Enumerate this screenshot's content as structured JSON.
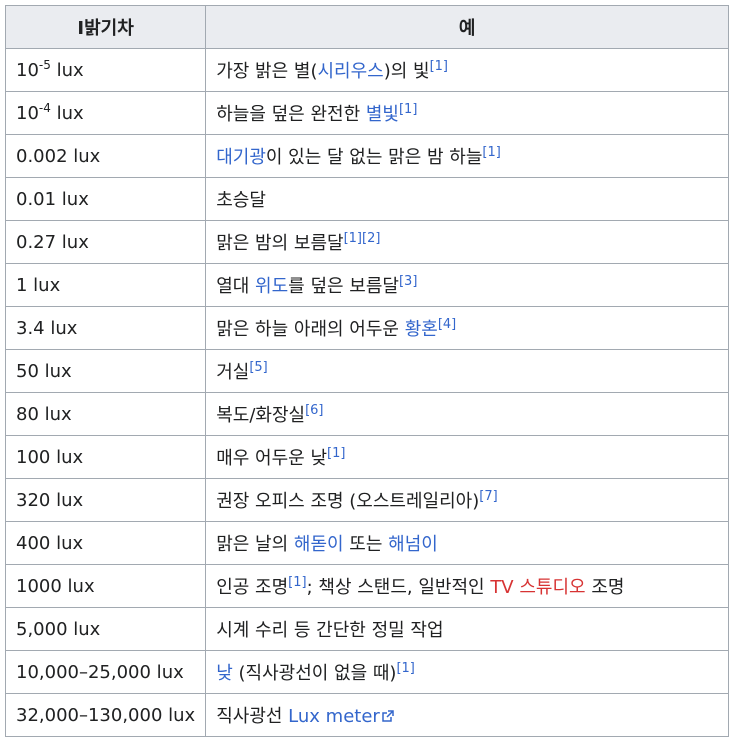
{
  "table": {
    "headers": [
      "I밝기차",
      "예"
    ],
    "rows": [
      {
        "lux": {
          "base": "10",
          "exp": "-5",
          "unit": " lux"
        },
        "parts": [
          {
            "t": "text",
            "v": "가장 밝은 별("
          },
          {
            "t": "link",
            "v": "시리우스"
          },
          {
            "t": "text",
            "v": ")의 빛"
          },
          {
            "t": "ref",
            "v": "[1]"
          }
        ]
      },
      {
        "lux": {
          "base": "10",
          "exp": "-4",
          "unit": " lux"
        },
        "parts": [
          {
            "t": "text",
            "v": "하늘을 덮은 완전한 "
          },
          {
            "t": "link",
            "v": "별빛"
          },
          {
            "t": "ref",
            "v": "[1]"
          }
        ]
      },
      {
        "lux": {
          "text": "0.002 lux"
        },
        "parts": [
          {
            "t": "link",
            "v": "대기광"
          },
          {
            "t": "text",
            "v": "이 있는 달 없는 맑은 밤 하늘"
          },
          {
            "t": "ref",
            "v": "[1]"
          }
        ]
      },
      {
        "lux": {
          "text": "0.01 lux"
        },
        "parts": [
          {
            "t": "text",
            "v": "초승달"
          }
        ]
      },
      {
        "lux": {
          "text": "0.27 lux"
        },
        "parts": [
          {
            "t": "text",
            "v": "맑은 밤의 보름달"
          },
          {
            "t": "ref",
            "v": "[1]"
          },
          {
            "t": "ref",
            "v": "[2]"
          }
        ]
      },
      {
        "lux": {
          "text": "1 lux"
        },
        "parts": [
          {
            "t": "text",
            "v": "열대 "
          },
          {
            "t": "link",
            "v": "위도"
          },
          {
            "t": "text",
            "v": "를 덮은 보름달"
          },
          {
            "t": "ref",
            "v": "[3]"
          }
        ]
      },
      {
        "lux": {
          "text": "3.4 lux"
        },
        "parts": [
          {
            "t": "text",
            "v": "맑은 하늘 아래의 어두운 "
          },
          {
            "t": "link",
            "v": "황혼"
          },
          {
            "t": "ref",
            "v": "[4]"
          }
        ]
      },
      {
        "lux": {
          "text": "50 lux"
        },
        "parts": [
          {
            "t": "text",
            "v": "거실"
          },
          {
            "t": "ref",
            "v": "[5]"
          }
        ]
      },
      {
        "lux": {
          "text": "80 lux"
        },
        "parts": [
          {
            "t": "text",
            "v": "복도/화장실"
          },
          {
            "t": "ref",
            "v": "[6]"
          }
        ]
      },
      {
        "lux": {
          "text": "100 lux"
        },
        "parts": [
          {
            "t": "text",
            "v": "매우 어두운 낮"
          },
          {
            "t": "ref",
            "v": "[1]"
          }
        ]
      },
      {
        "lux": {
          "text": "320 lux"
        },
        "parts": [
          {
            "t": "text",
            "v": "권장 오피스 조명 (오스트레일리아)"
          },
          {
            "t": "ref",
            "v": "[7]"
          }
        ]
      },
      {
        "lux": {
          "text": "400 lux"
        },
        "parts": [
          {
            "t": "text",
            "v": "맑은 날의 "
          },
          {
            "t": "link",
            "v": "해돋이"
          },
          {
            "t": "text",
            "v": " 또는 "
          },
          {
            "t": "link",
            "v": "해넘이"
          }
        ]
      },
      {
        "lux": {
          "text": "1000 lux"
        },
        "parts": [
          {
            "t": "text",
            "v": "인공 조명"
          },
          {
            "t": "ref",
            "v": "[1]"
          },
          {
            "t": "text",
            "v": "; 책상 스탠드, 일반적인 "
          },
          {
            "t": "newlink",
            "v": "TV 스튜디오"
          },
          {
            "t": "text",
            "v": " 조명"
          }
        ]
      },
      {
        "lux": {
          "text": "5,000 lux"
        },
        "parts": [
          {
            "t": "text",
            "v": "시계 수리 등 간단한 정밀 작업"
          }
        ]
      },
      {
        "lux": {
          "text": "10,000–25,000 lux"
        },
        "parts": [
          {
            "t": "link",
            "v": "낮"
          },
          {
            "t": "text",
            "v": " (직사광선이 없을 때)"
          },
          {
            "t": "ref",
            "v": "[1]"
          }
        ]
      },
      {
        "lux": {
          "text": "32,000–130,000 lux"
        },
        "parts": [
          {
            "t": "text",
            "v": "직사광선 "
          },
          {
            "t": "extlink",
            "v": "Lux meter"
          }
        ]
      }
    ]
  },
  "icons": {
    "external": "external-link-icon"
  },
  "colors": {
    "link": "#3366cc",
    "new_link": "#d73333",
    "border": "#a2a9b1",
    "header_bg": "#eaecf0"
  }
}
